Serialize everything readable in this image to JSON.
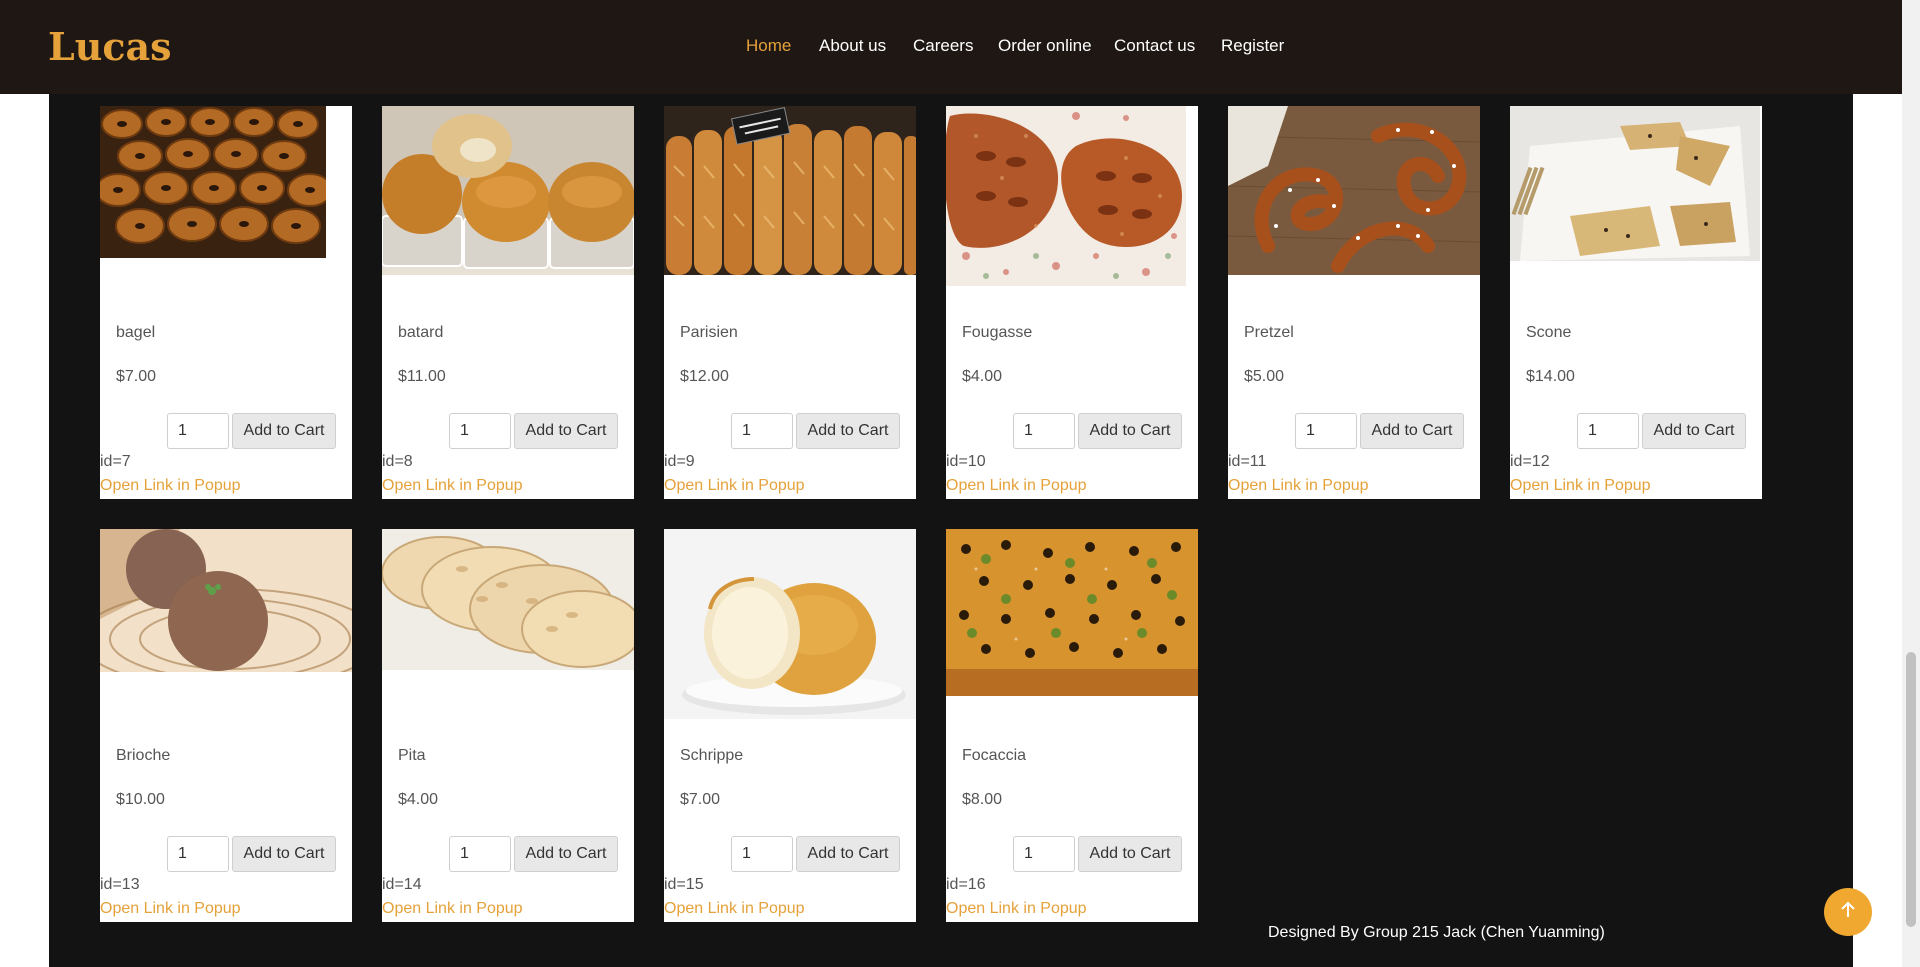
{
  "brand": {
    "name": "Lucas"
  },
  "nav": {
    "items": [
      {
        "label": "Home",
        "active": true
      },
      {
        "label": "About us",
        "active": false
      },
      {
        "label": "Careers",
        "active": false
      },
      {
        "label": "Order online",
        "active": false
      },
      {
        "label": "Contact us",
        "active": false
      },
      {
        "label": "Register",
        "active": false
      }
    ]
  },
  "products": [
    {
      "name": "bagel",
      "price": "$7.00",
      "qty": "1",
      "add_label": "Add to Cart",
      "id_label": "id=7",
      "link_label": "Open Link in Popup",
      "image": "bagel-photo"
    },
    {
      "name": "batard",
      "price": "$11.00",
      "qty": "1",
      "add_label": "Add to Cart",
      "id_label": "id=8",
      "link_label": "Open Link in Popup",
      "image": "batard-photo"
    },
    {
      "name": "Parisien",
      "price": "$12.00",
      "qty": "1",
      "add_label": "Add to Cart",
      "id_label": "id=9",
      "link_label": "Open Link in Popup",
      "image": "parisien-photo"
    },
    {
      "name": "Fougasse",
      "price": "$4.00",
      "qty": "1",
      "add_label": "Add to Cart",
      "id_label": "id=10",
      "link_label": "Open Link in Popup",
      "image": "fougasse-photo"
    },
    {
      "name": "Pretzel",
      "price": "$5.00",
      "qty": "1",
      "add_label": "Add to Cart",
      "id_label": "id=11",
      "link_label": "Open Link in Popup",
      "image": "pretzel-photo"
    },
    {
      "name": "Scone",
      "price": "$14.00",
      "qty": "1",
      "add_label": "Add to Cart",
      "id_label": "id=12",
      "link_label": "Open Link in Popup",
      "image": "scone-photo"
    },
    {
      "name": "Brioche",
      "price": "$10.00",
      "qty": "1",
      "add_label": "Add to Cart",
      "id_label": "id=13",
      "link_label": "Open Link in Popup",
      "image": "brioche-photo"
    },
    {
      "name": "Pita",
      "price": "$4.00",
      "qty": "1",
      "add_label": "Add to Cart",
      "id_label": "id=14",
      "link_label": "Open Link in Popup",
      "image": "pita-photo"
    },
    {
      "name": "Schrippe",
      "price": "$7.00",
      "qty": "1",
      "add_label": "Add to Cart",
      "id_label": "id=15",
      "link_label": "Open Link in Popup",
      "image": "schrippe-photo"
    },
    {
      "name": "Focaccia",
      "price": "$8.00",
      "qty": "1",
      "add_label": "Add to Cart",
      "id_label": "id=16",
      "link_label": "Open Link in Popup",
      "image": "focaccia-photo"
    }
  ],
  "footer": {
    "credit": "Designed By Group 215 Jack (Chen Yuanming)"
  },
  "colors": {
    "accent": "#e5a13a",
    "header_bg": "#1e1714",
    "main_bg": "#131313",
    "back_to_top": "#f0a830"
  },
  "icons": {
    "back_to_top": "arrow-up-icon"
  }
}
